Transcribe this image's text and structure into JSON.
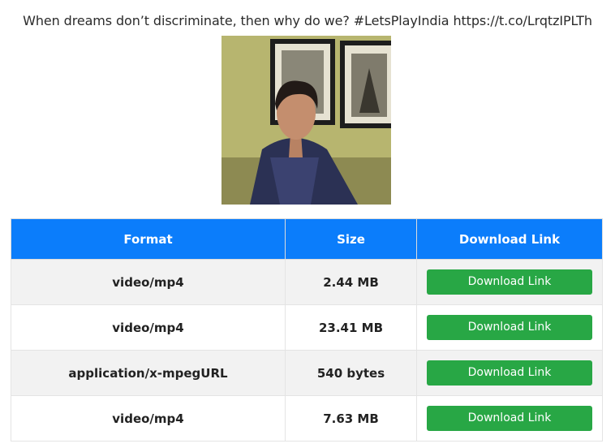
{
  "page": {
    "title": "When dreams don’t discriminate, then why do we? #LetsPlayIndia https://t.co/LrqtzIPLTh"
  },
  "thumbnail": {
    "icon": "video-thumbnail-man-in-plaid-shirt"
  },
  "table": {
    "headers": {
      "format": "Format",
      "size": "Size",
      "download": "Download Link"
    },
    "rows": [
      {
        "format": "video/mp4",
        "size": "2.44 MB",
        "button": "Download Link"
      },
      {
        "format": "video/mp4",
        "size": "23.41 MB",
        "button": "Download Link"
      },
      {
        "format": "application/x-mpegURL",
        "size": "540 bytes",
        "button": "Download Link"
      },
      {
        "format": "video/mp4",
        "size": "7.63 MB",
        "button": "Download Link"
      }
    ]
  },
  "colors": {
    "header_bg": "#0b7dfb",
    "button_bg": "#28a745",
    "row_alt_bg": "#f2f2f2"
  }
}
